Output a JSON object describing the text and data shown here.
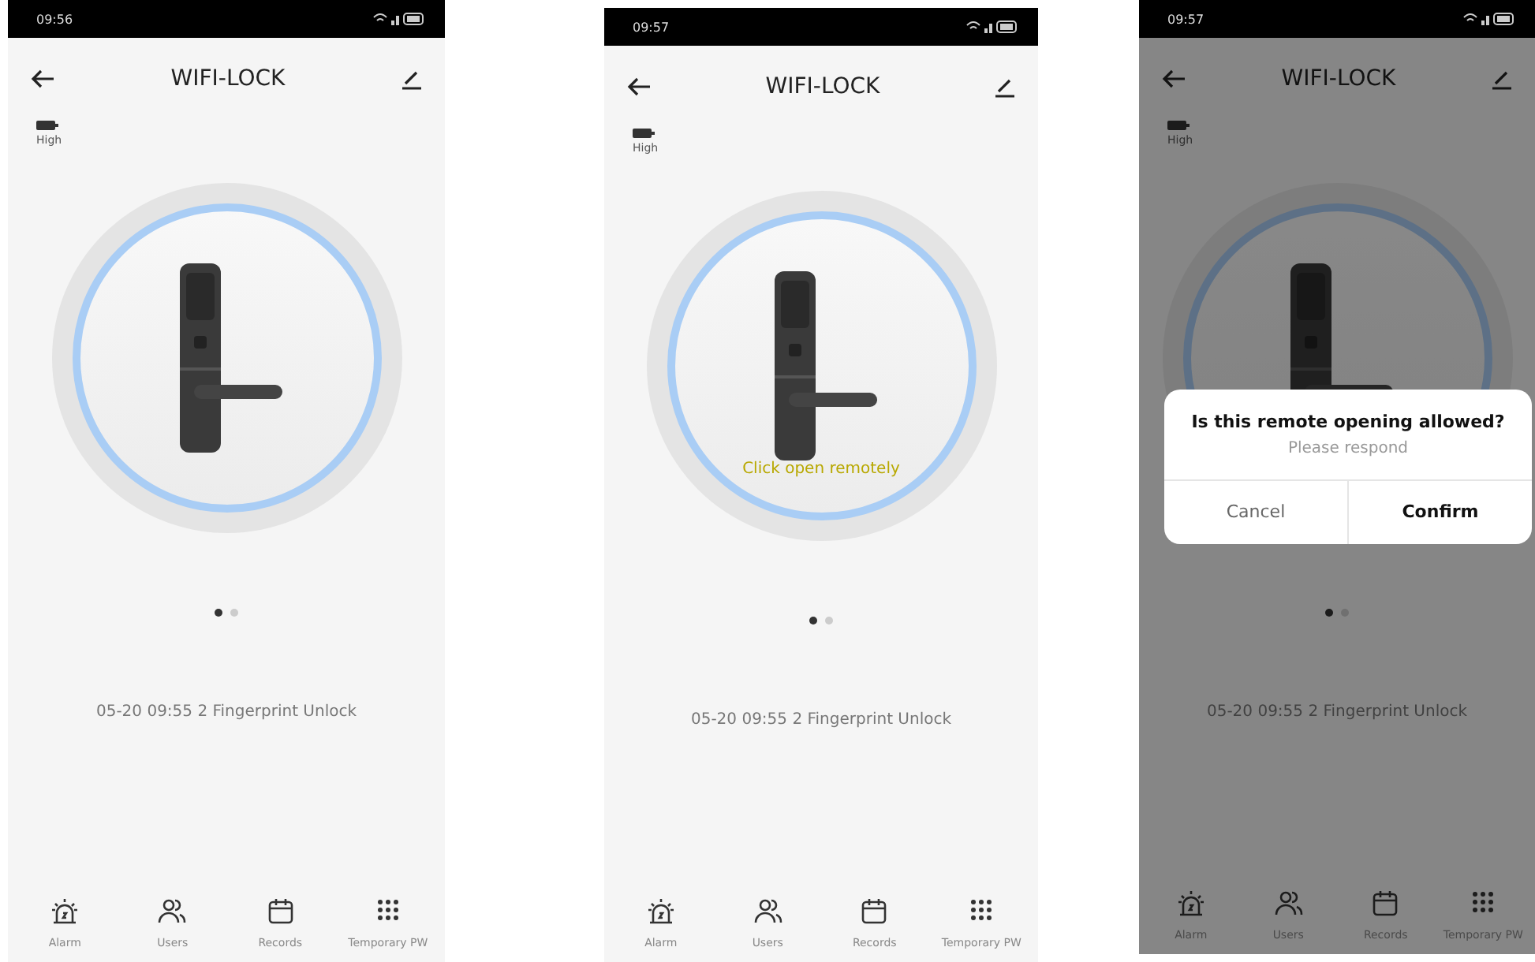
{
  "screens": [
    {
      "status_bar": {
        "time": "09:56"
      },
      "title": "WIFI-LOCK",
      "battery": {
        "label": "High"
      },
      "page_dots": [
        {
          "selected": true
        },
        {
          "selected": false
        }
      ],
      "last_record": "05-20 09:55  2 Fingerprint Unlock",
      "nav": [
        {
          "label": "Alarm"
        },
        {
          "label": "Users"
        },
        {
          "label": "Records"
        },
        {
          "label": "Temporary PW"
        }
      ],
      "dimmed": false
    },
    {
      "status_bar": {
        "time": "09:57"
      },
      "title": "WIFI-LOCK",
      "battery": {
        "label": "High"
      },
      "remote_hint": "Click open remotely",
      "page_dots": [
        {
          "selected": true
        },
        {
          "selected": false
        }
      ],
      "last_record": "05-20 09:55  2 Fingerprint Unlock",
      "nav": [
        {
          "label": "Alarm"
        },
        {
          "label": "Users"
        },
        {
          "label": "Records"
        },
        {
          "label": "Temporary PW"
        }
      ],
      "dimmed": false
    },
    {
      "status_bar": {
        "time": "09:57"
      },
      "title": "WIFI-LOCK",
      "battery": {
        "label": "High"
      },
      "page_dots": [
        {
          "selected": true
        },
        {
          "selected": false
        }
      ],
      "last_record": "05-20 09:55  2 Fingerprint Unlock",
      "nav": [
        {
          "label": "Alarm"
        },
        {
          "label": "Users"
        },
        {
          "label": "Records"
        },
        {
          "label": "Temporary PW"
        }
      ],
      "dimmed": true,
      "dialog": {
        "title": "Is this remote opening allowed?",
        "message": "Please respond",
        "buttons": [
          {
            "label": "Cancel",
            "primary": false
          },
          {
            "label": "Confirm",
            "primary": true
          }
        ]
      }
    }
  ]
}
